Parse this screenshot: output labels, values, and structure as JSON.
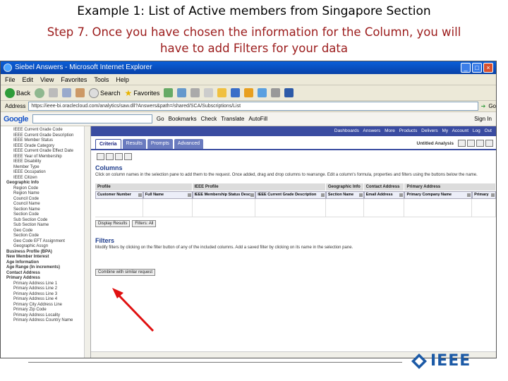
{
  "slide": {
    "title": "Example 1: List of Active members from Singapore Section",
    "step_line1": "Step 7. Once you have chosen the information for the Column, you will",
    "step_line2": "have to add Filters for your data",
    "logo_text": "IEEE"
  },
  "browser": {
    "window_title": "Siebel Answers - Microsoft Internet Explorer",
    "menu": [
      "File",
      "Edit",
      "View",
      "Favorites",
      "Tools",
      "Help"
    ],
    "toolbar": {
      "back": "Back",
      "search": "Search",
      "favorites": "Favorites"
    },
    "address_label": "Address",
    "address_value": "https://ieee-bi.oraclecloud.com/analytics/saw.dll?Answers&path=/shared/SCA/Subscriptions/List",
    "go_label": "Go",
    "google": {
      "logo": "Google",
      "go": "Go",
      "bookmarks": "Bookmarks",
      "check": "Check",
      "translate": "Translate",
      "autofill": "AutoFill",
      "sign_in": "Sign In"
    }
  },
  "sidebar": {
    "items": [
      {
        "label": "IEEE Current Grade Code",
        "level": 2
      },
      {
        "label": "IEEE Current Grade Description",
        "level": 2
      },
      {
        "label": "IEEE Member Status",
        "level": 2
      },
      {
        "label": "IEEE Grade Category",
        "level": 2
      },
      {
        "label": "IEEE Current Grade Effect Date",
        "level": 2
      },
      {
        "label": "IEEE Year of Membership",
        "level": 2
      },
      {
        "label": "IEEE Disability",
        "level": 2
      },
      {
        "label": "Member Type",
        "level": 2
      },
      {
        "label": "IEEE Occupation",
        "level": 2
      },
      {
        "label": "IEEE Citizen",
        "level": 2
      },
      {
        "label": "Geographic Info",
        "level": 1
      },
      {
        "label": "Region Code",
        "level": 2
      },
      {
        "label": "Region Name",
        "level": 2
      },
      {
        "label": "Council Code",
        "level": 2
      },
      {
        "label": "Council Name",
        "level": 2
      },
      {
        "label": "Section Name",
        "level": 2
      },
      {
        "label": "Section Code",
        "level": 2
      },
      {
        "label": "Sub Section Code",
        "level": 2
      },
      {
        "label": "Sub Section Name",
        "level": 2
      },
      {
        "label": "Geo Code",
        "level": 2
      },
      {
        "label": "Section Code",
        "level": 2
      },
      {
        "label": "Geo Code EFT Assignment",
        "level": 2
      },
      {
        "label": "Geographic Assgn",
        "level": 2
      },
      {
        "label": "Business Profile (BPA)",
        "level": 1
      },
      {
        "label": "New Member Interest",
        "level": 1
      },
      {
        "label": "Age Information",
        "level": 1
      },
      {
        "label": "Age Range (In increments)",
        "level": 1
      },
      {
        "label": "Contact Address",
        "level": 1
      },
      {
        "label": "Primary Address",
        "level": 1
      },
      {
        "label": "Primary Address Line 1",
        "level": 2
      },
      {
        "label": "Primary Address Line 2",
        "level": 2
      },
      {
        "label": "Primary Address Line 3",
        "level": 2
      },
      {
        "label": "Primary Address Line 4",
        "level": 2
      },
      {
        "label": "Primary City Address Line",
        "level": 2
      },
      {
        "label": "Primary Zip Code",
        "level": 2
      },
      {
        "label": "Primary Address Locality",
        "level": 2
      },
      {
        "label": "Primary Address Country Name",
        "level": 2
      }
    ]
  },
  "oracle": {
    "topnav": "Dashboards Answers More Products Delivers My Account Log Out",
    "tabs": [
      "Criteria",
      "Results",
      "Prompts",
      "Advanced"
    ],
    "active_tab": "Criteria",
    "untitled": "Untitled Analysis",
    "columns_heading": "Columns",
    "columns_desc": "Click on column names in the selection pane to add them to the request. Once added, drag and drop columns to rearrange. Edit a column's formula, properties and filters using the buttons below the name.",
    "groups": [
      "Profile",
      "IEEE Profile",
      "Geographic Info",
      "Contact Address",
      "Primary Address"
    ],
    "columns": [
      "Customer Number",
      "Full Name",
      "IEEE Membership Status Desc",
      "IEEE Current Grade Description",
      "Section Name",
      "Email Address",
      "Primary Company Name",
      "Primary"
    ],
    "display_results": "Display Results",
    "filters_all": "Filters: All",
    "filters_heading": "Filters",
    "filters_desc": "Modify filters by clicking on the filter button of any of the included columns. Add a saved filter by clicking on its name in the selection pane.",
    "combine_btn": "Combine with similar request"
  },
  "colors": {
    "accent": "#3a4ca1",
    "slide_red": "#9b1b1b",
    "arrow": "#e01010",
    "ieee_blue": "#1c5aa6"
  }
}
